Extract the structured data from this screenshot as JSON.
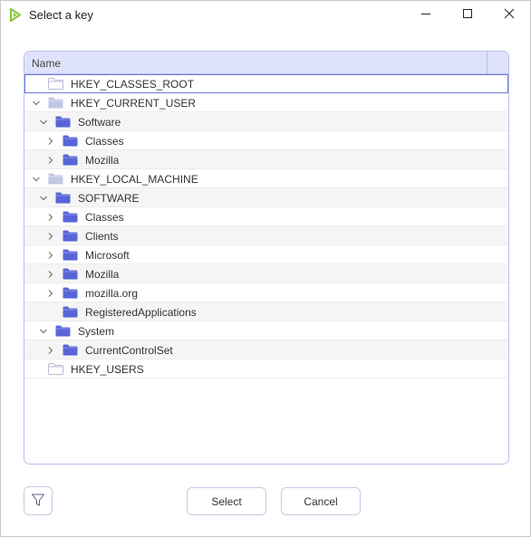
{
  "window": {
    "title": "Select a key",
    "controls": {
      "minimize": "minimize-icon",
      "maximize": "maximize-icon",
      "close": "close-icon"
    }
  },
  "tree": {
    "column_header": "Name",
    "rows": [
      {
        "label": "HKEY_CLASSES_ROOT",
        "depth": 0,
        "expander": "none",
        "folder": "hive-empty",
        "selected": true,
        "alt": false
      },
      {
        "label": "HKEY_CURRENT_USER",
        "depth": 0,
        "expander": "expanded",
        "folder": "hive",
        "selected": false,
        "alt": false
      },
      {
        "label": "Software",
        "depth": 1,
        "expander": "expanded",
        "folder": "key",
        "selected": false,
        "alt": true
      },
      {
        "label": "Classes",
        "depth": 2,
        "expander": "collapsed",
        "folder": "key",
        "selected": false,
        "alt": false
      },
      {
        "label": "Mozilla",
        "depth": 2,
        "expander": "collapsed",
        "folder": "key",
        "selected": false,
        "alt": true
      },
      {
        "label": "HKEY_LOCAL_MACHINE",
        "depth": 0,
        "expander": "expanded",
        "folder": "hive",
        "selected": false,
        "alt": false
      },
      {
        "label": "SOFTWARE",
        "depth": 1,
        "expander": "expanded",
        "folder": "key",
        "selected": false,
        "alt": true
      },
      {
        "label": "Classes",
        "depth": 2,
        "expander": "collapsed",
        "folder": "key",
        "selected": false,
        "alt": false
      },
      {
        "label": "Clients",
        "depth": 2,
        "expander": "collapsed",
        "folder": "key",
        "selected": false,
        "alt": true
      },
      {
        "label": "Microsoft",
        "depth": 2,
        "expander": "collapsed",
        "folder": "key",
        "selected": false,
        "alt": false
      },
      {
        "label": "Mozilla",
        "depth": 2,
        "expander": "collapsed",
        "folder": "key",
        "selected": false,
        "alt": true
      },
      {
        "label": "mozilla.org",
        "depth": 2,
        "expander": "collapsed",
        "folder": "key",
        "selected": false,
        "alt": false
      },
      {
        "label": "RegisteredApplications",
        "depth": 2,
        "expander": "none",
        "folder": "key",
        "selected": false,
        "alt": true
      },
      {
        "label": "System",
        "depth": 1,
        "expander": "expanded",
        "folder": "key",
        "selected": false,
        "alt": false
      },
      {
        "label": "CurrentControlSet",
        "depth": 2,
        "expander": "collapsed",
        "folder": "key",
        "selected": false,
        "alt": true
      },
      {
        "label": "HKEY_USERS",
        "depth": 0,
        "expander": "none",
        "folder": "hive-empty",
        "selected": false,
        "alt": false
      }
    ]
  },
  "footer": {
    "filter_icon": "filter-icon",
    "select_label": "Select",
    "cancel_label": "Cancel"
  },
  "colors": {
    "accent": "#5a66d6",
    "header_bg": "#dfe2fb",
    "folder_key": "#5865d8",
    "folder_hive": "#c3c7e6",
    "app_icon": "#8cc63f"
  }
}
